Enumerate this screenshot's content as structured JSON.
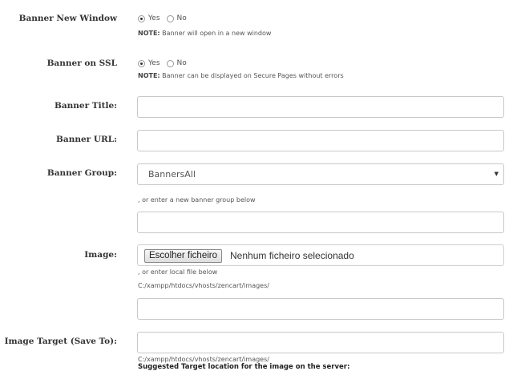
{
  "banner_new_window": {
    "label": "Banner New Window",
    "yes": "Yes",
    "no": "No",
    "selected": "Yes",
    "note_bold": "NOTE:",
    "note_text": " Banner will open in a new window"
  },
  "banner_on_ssl": {
    "label": "Banner on SSL",
    "yes": "Yes",
    "no": "No",
    "selected": "Yes",
    "note_bold": "NOTE:",
    "note_text": " Banner can be displayed on Secure Pages without errors"
  },
  "banner_title": {
    "label": "Banner Title:",
    "value": ""
  },
  "banner_url": {
    "label": "Banner URL:",
    "value": ""
  },
  "banner_group": {
    "label": "Banner Group:",
    "selected": "BannersAll",
    "hint": ", or enter a new banner group below",
    "new_group_value": ""
  },
  "image": {
    "label": "Image:",
    "file_button": "Escolher ficheiro",
    "file_status": "Nenhum ficheiro selecionado",
    "hint": ", or enter local file below",
    "path": "C:/xampp/htdocs/vhosts/zencart/images/",
    "local_value": ""
  },
  "image_target": {
    "label": "Image Target (Save To):",
    "value": "",
    "path": "C:/xampp/htdocs/vhosts/zencart/images/",
    "suggested": "Suggested Target location for the image on the server:"
  }
}
